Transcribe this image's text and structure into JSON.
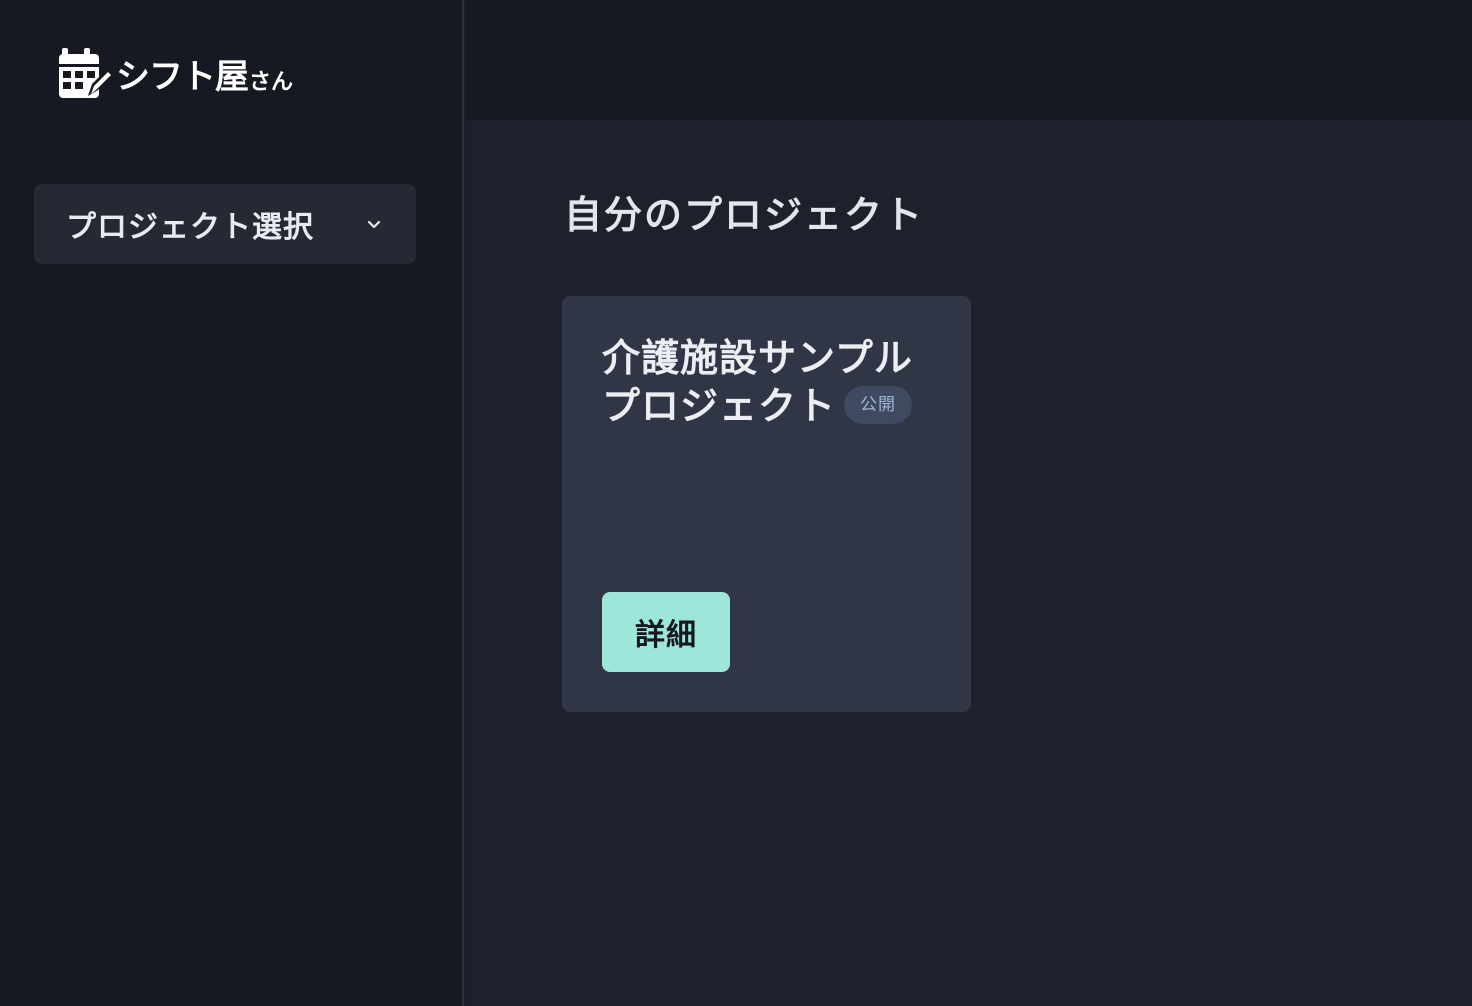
{
  "app": {
    "logo_text": "シフト屋",
    "logo_suffix": "さん"
  },
  "sidebar": {
    "project_select_label": "プロジェクト選択"
  },
  "main": {
    "title": "自分のプロジェクト",
    "cards": [
      {
        "title_line1": "介護施設サンプル",
        "title_line2": "プロジェクト",
        "badge": "公開",
        "button_label": "詳細"
      }
    ]
  },
  "colors": {
    "sidebar_bg": "#171922",
    "main_bg": "#1e212c",
    "card_bg": "#313646",
    "accent": "#9ee6d9",
    "badge_bg": "#3f4a60",
    "badge_text": "#9fb6d4"
  }
}
